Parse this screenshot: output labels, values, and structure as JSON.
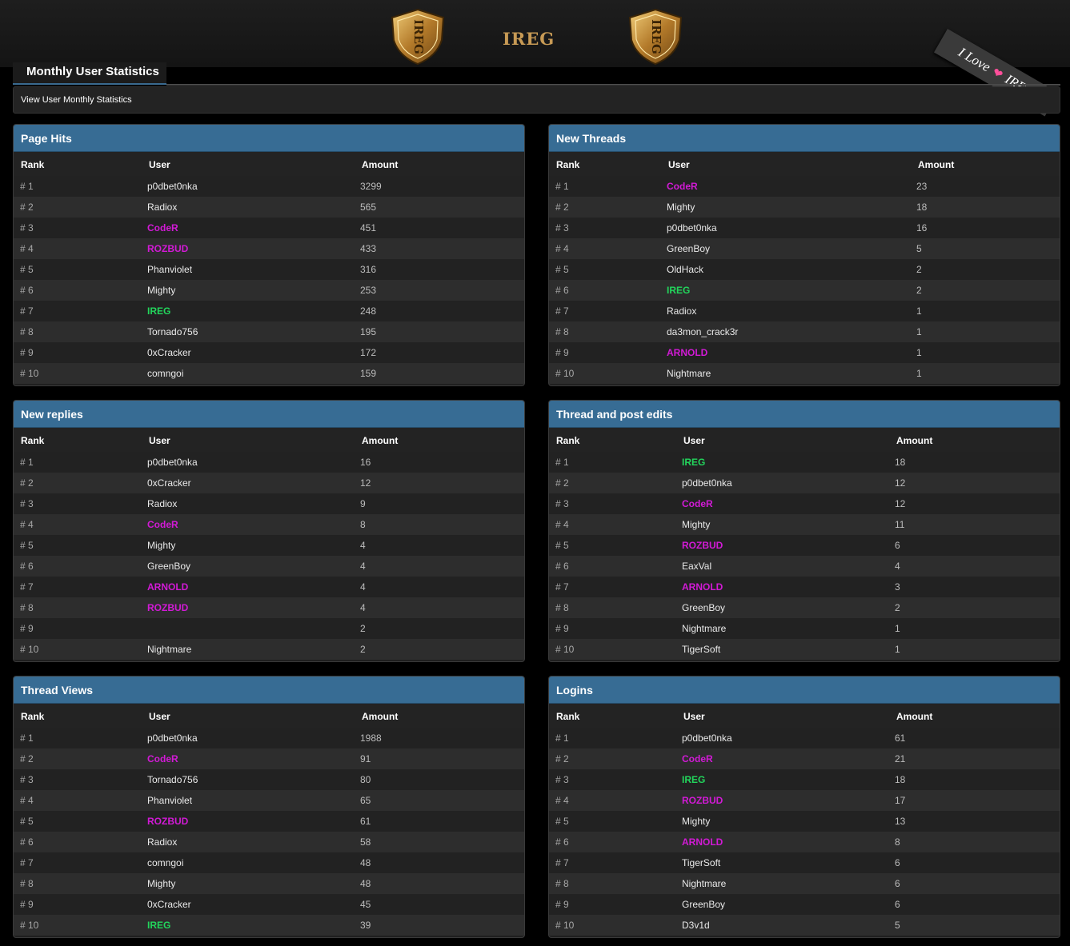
{
  "header": {
    "logo_text": "IREG",
    "shield_text": "IREG",
    "ribbon": {
      "pre": "I Love",
      "post": "IREG",
      "heart": "heart-icon"
    }
  },
  "page_title": "Monthly User Statistics",
  "subnav": {
    "link": "View User Monthly Statistics"
  },
  "columns": {
    "rank": "Rank",
    "user": "User",
    "amount": "Amount"
  },
  "colors": {
    "accent": "#376c94",
    "admin": "#d21ad6",
    "owner": "#22d65c"
  },
  "panels": [
    {
      "title": "Page Hits",
      "rows": [
        {
          "rank": "# 1",
          "user": "p0dbet0nka",
          "amount": "3299",
          "role": ""
        },
        {
          "rank": "# 2",
          "user": "Radiox",
          "amount": "565",
          "role": ""
        },
        {
          "rank": "# 3",
          "user": "CodeR",
          "amount": "451",
          "role": "mag"
        },
        {
          "rank": "# 4",
          "user": "ROZBUD",
          "amount": "433",
          "role": "mag"
        },
        {
          "rank": "# 5",
          "user": "Phanviolet",
          "amount": "316",
          "role": ""
        },
        {
          "rank": "# 6",
          "user": "Mighty",
          "amount": "253",
          "role": ""
        },
        {
          "rank": "# 7",
          "user": "IREG",
          "amount": "248",
          "role": "grn"
        },
        {
          "rank": "# 8",
          "user": "Tornado756",
          "amount": "195",
          "role": ""
        },
        {
          "rank": "# 9",
          "user": "0xCracker",
          "amount": "172",
          "role": ""
        },
        {
          "rank": "# 10",
          "user": "comngoi",
          "amount": "159",
          "role": ""
        }
      ]
    },
    {
      "title": "New Threads",
      "rows": [
        {
          "rank": "# 1",
          "user": "CodeR",
          "amount": "23",
          "role": "mag"
        },
        {
          "rank": "# 2",
          "user": "Mighty",
          "amount": "18",
          "role": ""
        },
        {
          "rank": "# 3",
          "user": "p0dbet0nka",
          "amount": "16",
          "role": ""
        },
        {
          "rank": "# 4",
          "user": "GreenBoy",
          "amount": "5",
          "role": ""
        },
        {
          "rank": "# 5",
          "user": "OldHack",
          "amount": "2",
          "role": ""
        },
        {
          "rank": "# 6",
          "user": "IREG",
          "amount": "2",
          "role": "grn"
        },
        {
          "rank": "# 7",
          "user": "Radiox",
          "amount": "1",
          "role": ""
        },
        {
          "rank": "# 8",
          "user": "da3mon_crack3r",
          "amount": "1",
          "role": ""
        },
        {
          "rank": "# 9",
          "user": "ARNOLD",
          "amount": "1",
          "role": "mag"
        },
        {
          "rank": "# 10",
          "user": "Nightmare",
          "amount": "1",
          "role": ""
        }
      ]
    },
    {
      "title": "New replies",
      "rows": [
        {
          "rank": "# 1",
          "user": "p0dbet0nka",
          "amount": "16",
          "role": ""
        },
        {
          "rank": "# 2",
          "user": "0xCracker",
          "amount": "12",
          "role": ""
        },
        {
          "rank": "# 3",
          "user": "Radiox",
          "amount": "9",
          "role": ""
        },
        {
          "rank": "# 4",
          "user": "CodeR",
          "amount": "8",
          "role": "mag"
        },
        {
          "rank": "# 5",
          "user": "Mighty",
          "amount": "4",
          "role": ""
        },
        {
          "rank": "# 6",
          "user": "GreenBoy",
          "amount": "4",
          "role": ""
        },
        {
          "rank": "# 7",
          "user": "ARNOLD",
          "amount": "4",
          "role": "mag"
        },
        {
          "rank": "# 8",
          "user": "ROZBUD",
          "amount": "4",
          "role": "mag"
        },
        {
          "rank": "# 9",
          "user": "",
          "amount": "2",
          "role": ""
        },
        {
          "rank": "# 10",
          "user": "Nightmare",
          "amount": "2",
          "role": ""
        }
      ]
    },
    {
      "title": "Thread and post edits",
      "rows": [
        {
          "rank": "# 1",
          "user": "IREG",
          "amount": "18",
          "role": "grn"
        },
        {
          "rank": "# 2",
          "user": "p0dbet0nka",
          "amount": "12",
          "role": ""
        },
        {
          "rank": "# 3",
          "user": "CodeR",
          "amount": "12",
          "role": "mag"
        },
        {
          "rank": "# 4",
          "user": "Mighty",
          "amount": "11",
          "role": ""
        },
        {
          "rank": "# 5",
          "user": "ROZBUD",
          "amount": "6",
          "role": "mag"
        },
        {
          "rank": "# 6",
          "user": "EaxVal",
          "amount": "4",
          "role": ""
        },
        {
          "rank": "# 7",
          "user": "ARNOLD",
          "amount": "3",
          "role": "mag"
        },
        {
          "rank": "# 8",
          "user": "GreenBoy",
          "amount": "2",
          "role": ""
        },
        {
          "rank": "# 9",
          "user": "Nightmare",
          "amount": "1",
          "role": ""
        },
        {
          "rank": "# 10",
          "user": "TigerSoft",
          "amount": "1",
          "role": ""
        }
      ]
    },
    {
      "title": "Thread Views",
      "rows": [
        {
          "rank": "# 1",
          "user": "p0dbet0nka",
          "amount": "1988",
          "role": ""
        },
        {
          "rank": "# 2",
          "user": "CodeR",
          "amount": "91",
          "role": "mag"
        },
        {
          "rank": "# 3",
          "user": "Tornado756",
          "amount": "80",
          "role": ""
        },
        {
          "rank": "# 4",
          "user": "Phanviolet",
          "amount": "65",
          "role": ""
        },
        {
          "rank": "# 5",
          "user": "ROZBUD",
          "amount": "61",
          "role": "mag"
        },
        {
          "rank": "# 6",
          "user": "Radiox",
          "amount": "58",
          "role": ""
        },
        {
          "rank": "# 7",
          "user": "comngoi",
          "amount": "48",
          "role": ""
        },
        {
          "rank": "# 8",
          "user": "Mighty",
          "amount": "48",
          "role": ""
        },
        {
          "rank": "# 9",
          "user": "0xCracker",
          "amount": "45",
          "role": ""
        },
        {
          "rank": "# 10",
          "user": "IREG",
          "amount": "39",
          "role": "grn"
        }
      ]
    },
    {
      "title": "Logins",
      "rows": [
        {
          "rank": "# 1",
          "user": "p0dbet0nka",
          "amount": "61",
          "role": ""
        },
        {
          "rank": "# 2",
          "user": "CodeR",
          "amount": "21",
          "role": "mag"
        },
        {
          "rank": "# 3",
          "user": "IREG",
          "amount": "18",
          "role": "grn"
        },
        {
          "rank": "# 4",
          "user": "ROZBUD",
          "amount": "17",
          "role": "mag"
        },
        {
          "rank": "# 5",
          "user": "Mighty",
          "amount": "13",
          "role": ""
        },
        {
          "rank": "# 6",
          "user": "ARNOLD",
          "amount": "8",
          "role": "mag"
        },
        {
          "rank": "# 7",
          "user": "TigerSoft",
          "amount": "6",
          "role": ""
        },
        {
          "rank": "# 8",
          "user": "Nightmare",
          "amount": "6",
          "role": ""
        },
        {
          "rank": "# 9",
          "user": "GreenBoy",
          "amount": "6",
          "role": ""
        },
        {
          "rank": "# 10",
          "user": "D3v1d",
          "amount": "5",
          "role": ""
        }
      ]
    }
  ]
}
